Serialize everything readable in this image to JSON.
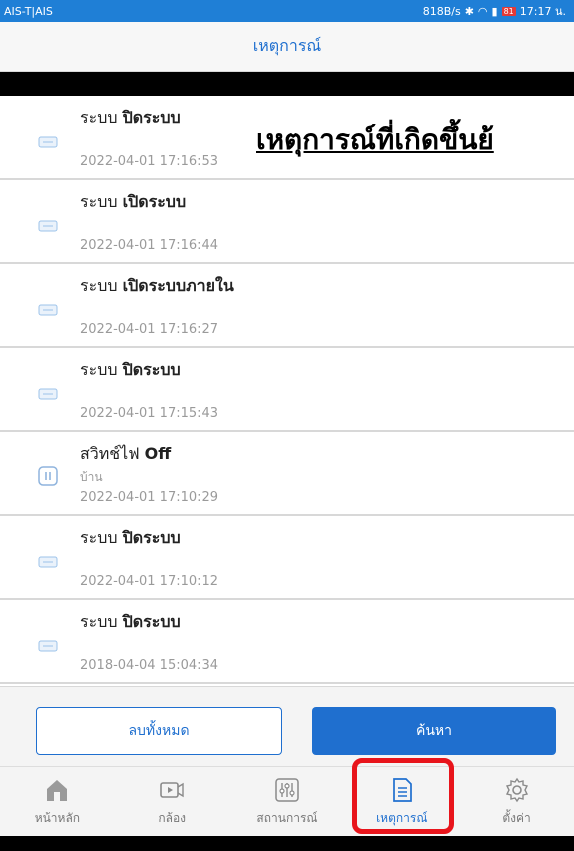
{
  "status_bar": {
    "carrier": "AIS-T|AIS",
    "speed": "818B/s",
    "battery": "81",
    "time": "17:17 น."
  },
  "header": {
    "title": "เหตุการณ์"
  },
  "overlay_heading": "เหตุการณ์ที่เกิดขึ้นย้",
  "events": [
    {
      "label": "ระบบ",
      "value": "ปิดระบบ",
      "sub": "",
      "time": "2022-04-01 17:16:53",
      "icon": "device-card-icon"
    },
    {
      "label": "ระบบ",
      "value": "เปิดระบบ",
      "sub": "",
      "time": "2022-04-01 17:16:44",
      "icon": "device-card-icon"
    },
    {
      "label": "ระบบ",
      "value": "เปิดระบบภายใน",
      "sub": "",
      "time": "2022-04-01 17:16:27",
      "icon": "device-card-icon"
    },
    {
      "label": "ระบบ",
      "value": "ปิดระบบ",
      "sub": "",
      "time": "2022-04-01 17:15:43",
      "icon": "device-card-icon"
    },
    {
      "label": "สวิทช์ไฟ",
      "value": "Off",
      "sub": "บ้าน",
      "time": "2022-04-01 17:10:29",
      "icon": "light-switch-icon"
    },
    {
      "label": "ระบบ",
      "value": "ปิดระบบ",
      "sub": "",
      "time": "2022-04-01 17:10:12",
      "icon": "device-card-icon"
    },
    {
      "label": "ระบบ",
      "value": "ปิดระบบ",
      "sub": "",
      "time": "2018-04-04 15:04:34",
      "icon": "device-card-icon"
    }
  ],
  "actions": {
    "clear_label": "ลบทั้งหมด",
    "search_label": "ค้นหา"
  },
  "tabs": [
    {
      "label": "หน้าหลัก",
      "icon": "home-icon"
    },
    {
      "label": "กล้อง",
      "icon": "camera-icon"
    },
    {
      "label": "สถานการณ์",
      "icon": "scenario-sliders-icon"
    },
    {
      "label": "เหตุการณ์",
      "icon": "document-icon"
    },
    {
      "label": "ตั้งค่า",
      "icon": "gear-icon"
    }
  ],
  "active_tab": "เหตุการณ์",
  "colors": {
    "accent": "#1f6fcf",
    "status_bar": "#1f7fd6",
    "highlight": "#e8141b"
  }
}
